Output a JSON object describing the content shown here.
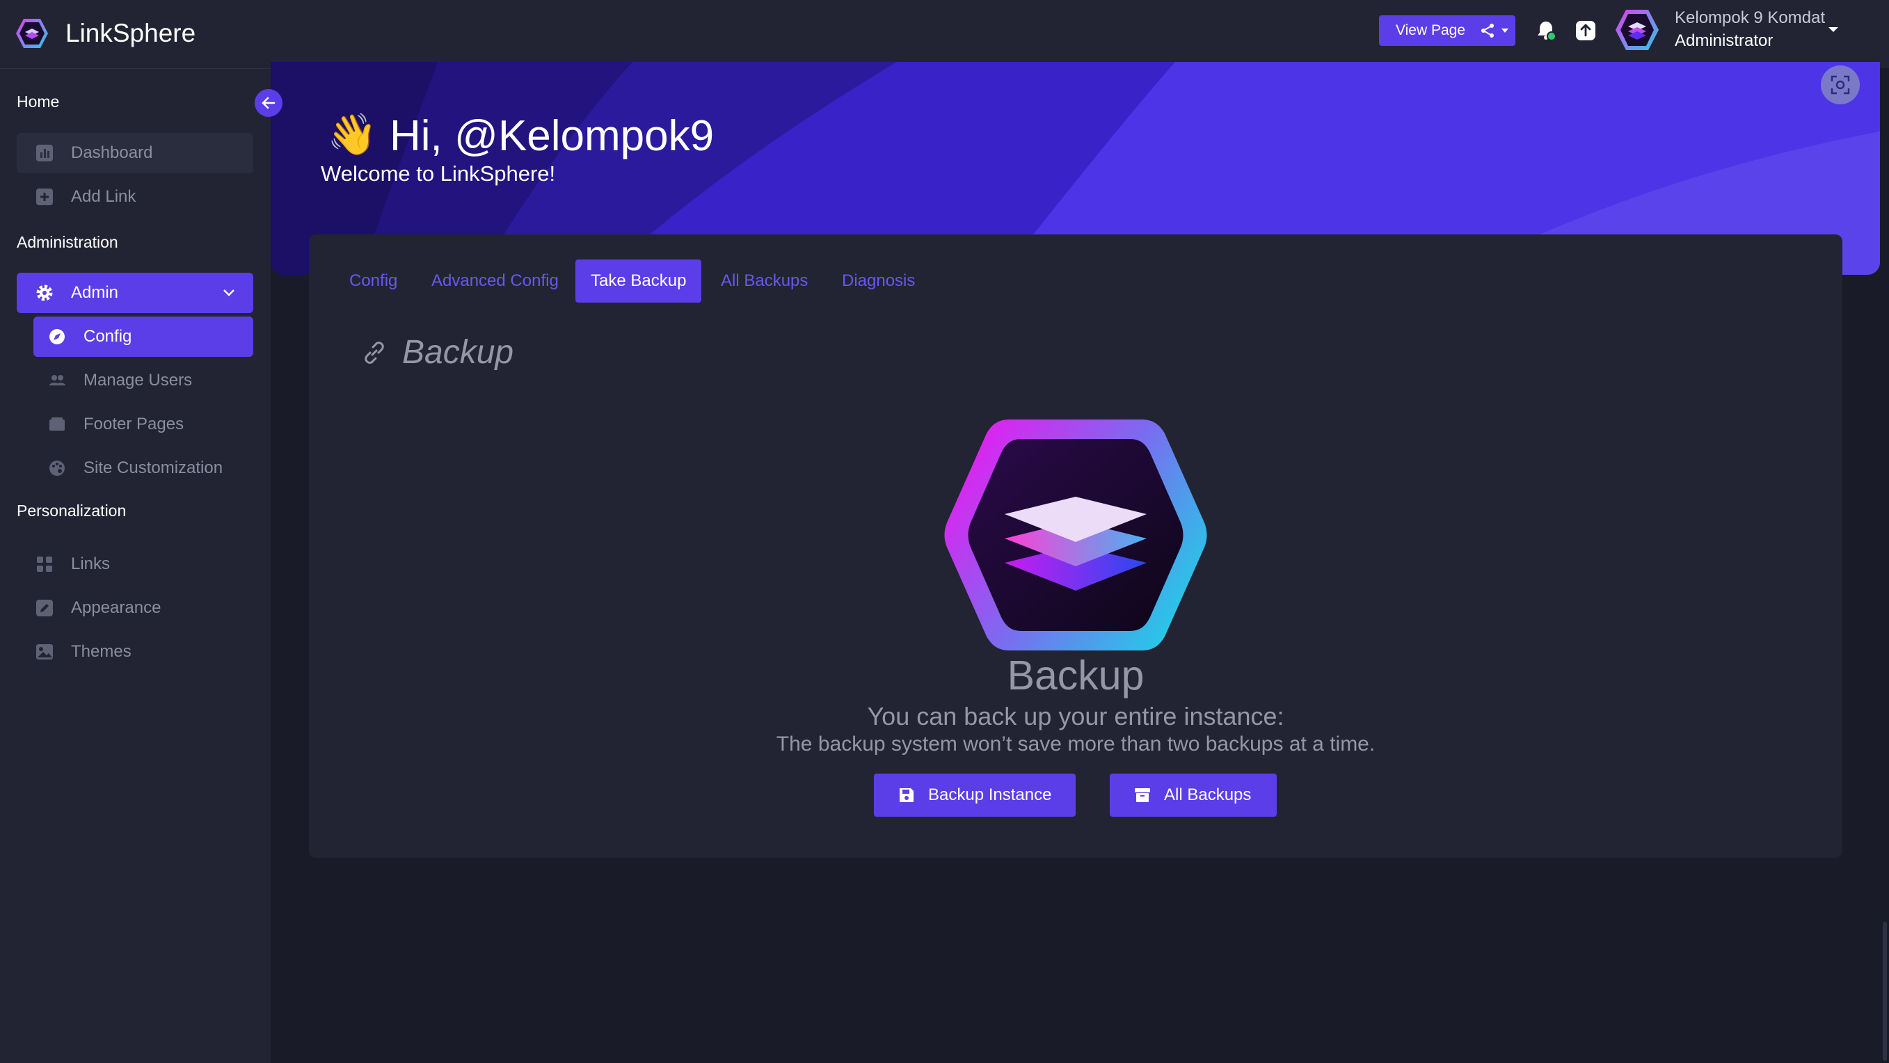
{
  "app": {
    "name": "LinkSphere"
  },
  "header": {
    "view_page_label": "View Page",
    "icons": [
      "share-icon",
      "notification-icon",
      "upload-icon"
    ],
    "user": {
      "name": "Kelompok 9 Komdat",
      "role": "Administrator"
    }
  },
  "sidebar": {
    "sections": {
      "home": "Home",
      "administration": "Administration",
      "personalization": "Personalization"
    },
    "items": {
      "dashboard": "Dashboard",
      "add_link": "Add Link",
      "admin": "Admin",
      "config": "Config",
      "manage_users": "Manage Users",
      "footer_pages": "Footer Pages",
      "site_customization": "Site Customization",
      "links": "Links",
      "appearance": "Appearance",
      "themes": "Themes"
    }
  },
  "hero": {
    "emoji": "👋",
    "greeting": "Hi, @Kelompok9",
    "subtitle": "Welcome to LinkSphere!"
  },
  "tabs": [
    "Config",
    "Advanced Config",
    "Take Backup",
    "All Backups",
    "Diagnosis"
  ],
  "active_tab": "Take Backup",
  "backup": {
    "section_title": "Backup",
    "title": "Backup",
    "line1": "You can back up your entire instance:",
    "line2": "The backup system won’t save more than two backups at a time.",
    "backup_instance_label": "Backup Instance",
    "all_backups_label": "All Backups"
  },
  "colors": {
    "accent": "#5b3ee8",
    "sidebar_bg": "#222433",
    "page_bg": "#191b29",
    "hero": "#4a2fd9"
  }
}
